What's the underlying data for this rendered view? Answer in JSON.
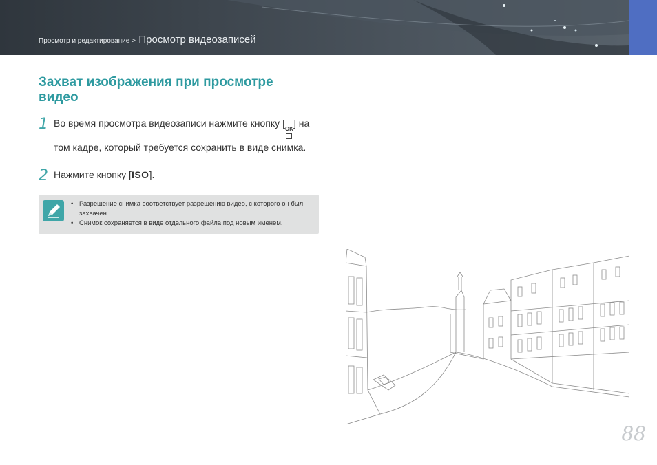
{
  "header": {
    "breadcrumb_section": "Просмотр и редактирование >",
    "breadcrumb_page": "Просмотр видеозаписей",
    "accent_color": "#4f6ec2"
  },
  "section": {
    "title": "Захват изображения при просмотре видео"
  },
  "steps": [
    {
      "number": "1",
      "text_before": "Во время просмотра видеозаписи нажмите кнопку [",
      "button_top": "OK",
      "text_after": "] на том кадре, который требуется сохранить в виде снимка."
    },
    {
      "number": "2",
      "text_before": "Нажмите кнопку [",
      "button": "ISO",
      "text_after": "]."
    }
  ],
  "note": {
    "icon": "pencil-note-icon",
    "items": [
      "Разрешение снимка соответствует разрешению видео, с которого он был захвачен.",
      "Снимок сохраняется в виде отдельного файла под новым именем."
    ]
  },
  "illustration": {
    "icon": "venice-canal-sketch"
  },
  "page_number": "88"
}
